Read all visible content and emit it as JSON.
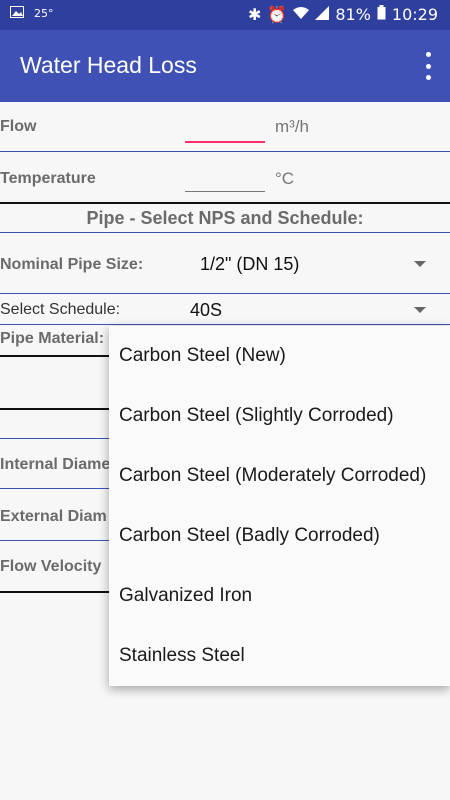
{
  "status_bar": {
    "temperature": "25°",
    "battery": "81%",
    "time": "10:29"
  },
  "app_bar": {
    "title": "Water Head Loss"
  },
  "flow": {
    "label": "Flow",
    "value": "",
    "unit": "m³/h"
  },
  "temperature": {
    "label": "Temperature",
    "value": "",
    "unit": "°C"
  },
  "pipe_section": {
    "title": "Pipe - Select NPS and Schedule:"
  },
  "nominal_pipe_size": {
    "label": "Nominal Pipe Size:",
    "selected": "1/2\" (DN 15)"
  },
  "schedule": {
    "label": "Select Schedule:",
    "selected": "40S"
  },
  "pipe_material": {
    "label": "Pipe Material:"
  },
  "internal_diameter": {
    "label": "Internal Diame"
  },
  "external_diameter": {
    "label": "External Diam"
  },
  "flow_velocity": {
    "label": "Flow Velocity"
  },
  "material_dropdown": {
    "options": [
      "Carbon Steel (New)",
      "Carbon Steel (Slightly Corroded)",
      "Carbon Steel (Moderately Corroded)",
      "Carbon Steel (Badly Corroded)",
      "Galvanized Iron",
      "Stainless Steel"
    ]
  },
  "colors": {
    "app_bar": "#3f51b5",
    "status_bar": "#2f3f9e",
    "accent": "#ff2d6a"
  }
}
